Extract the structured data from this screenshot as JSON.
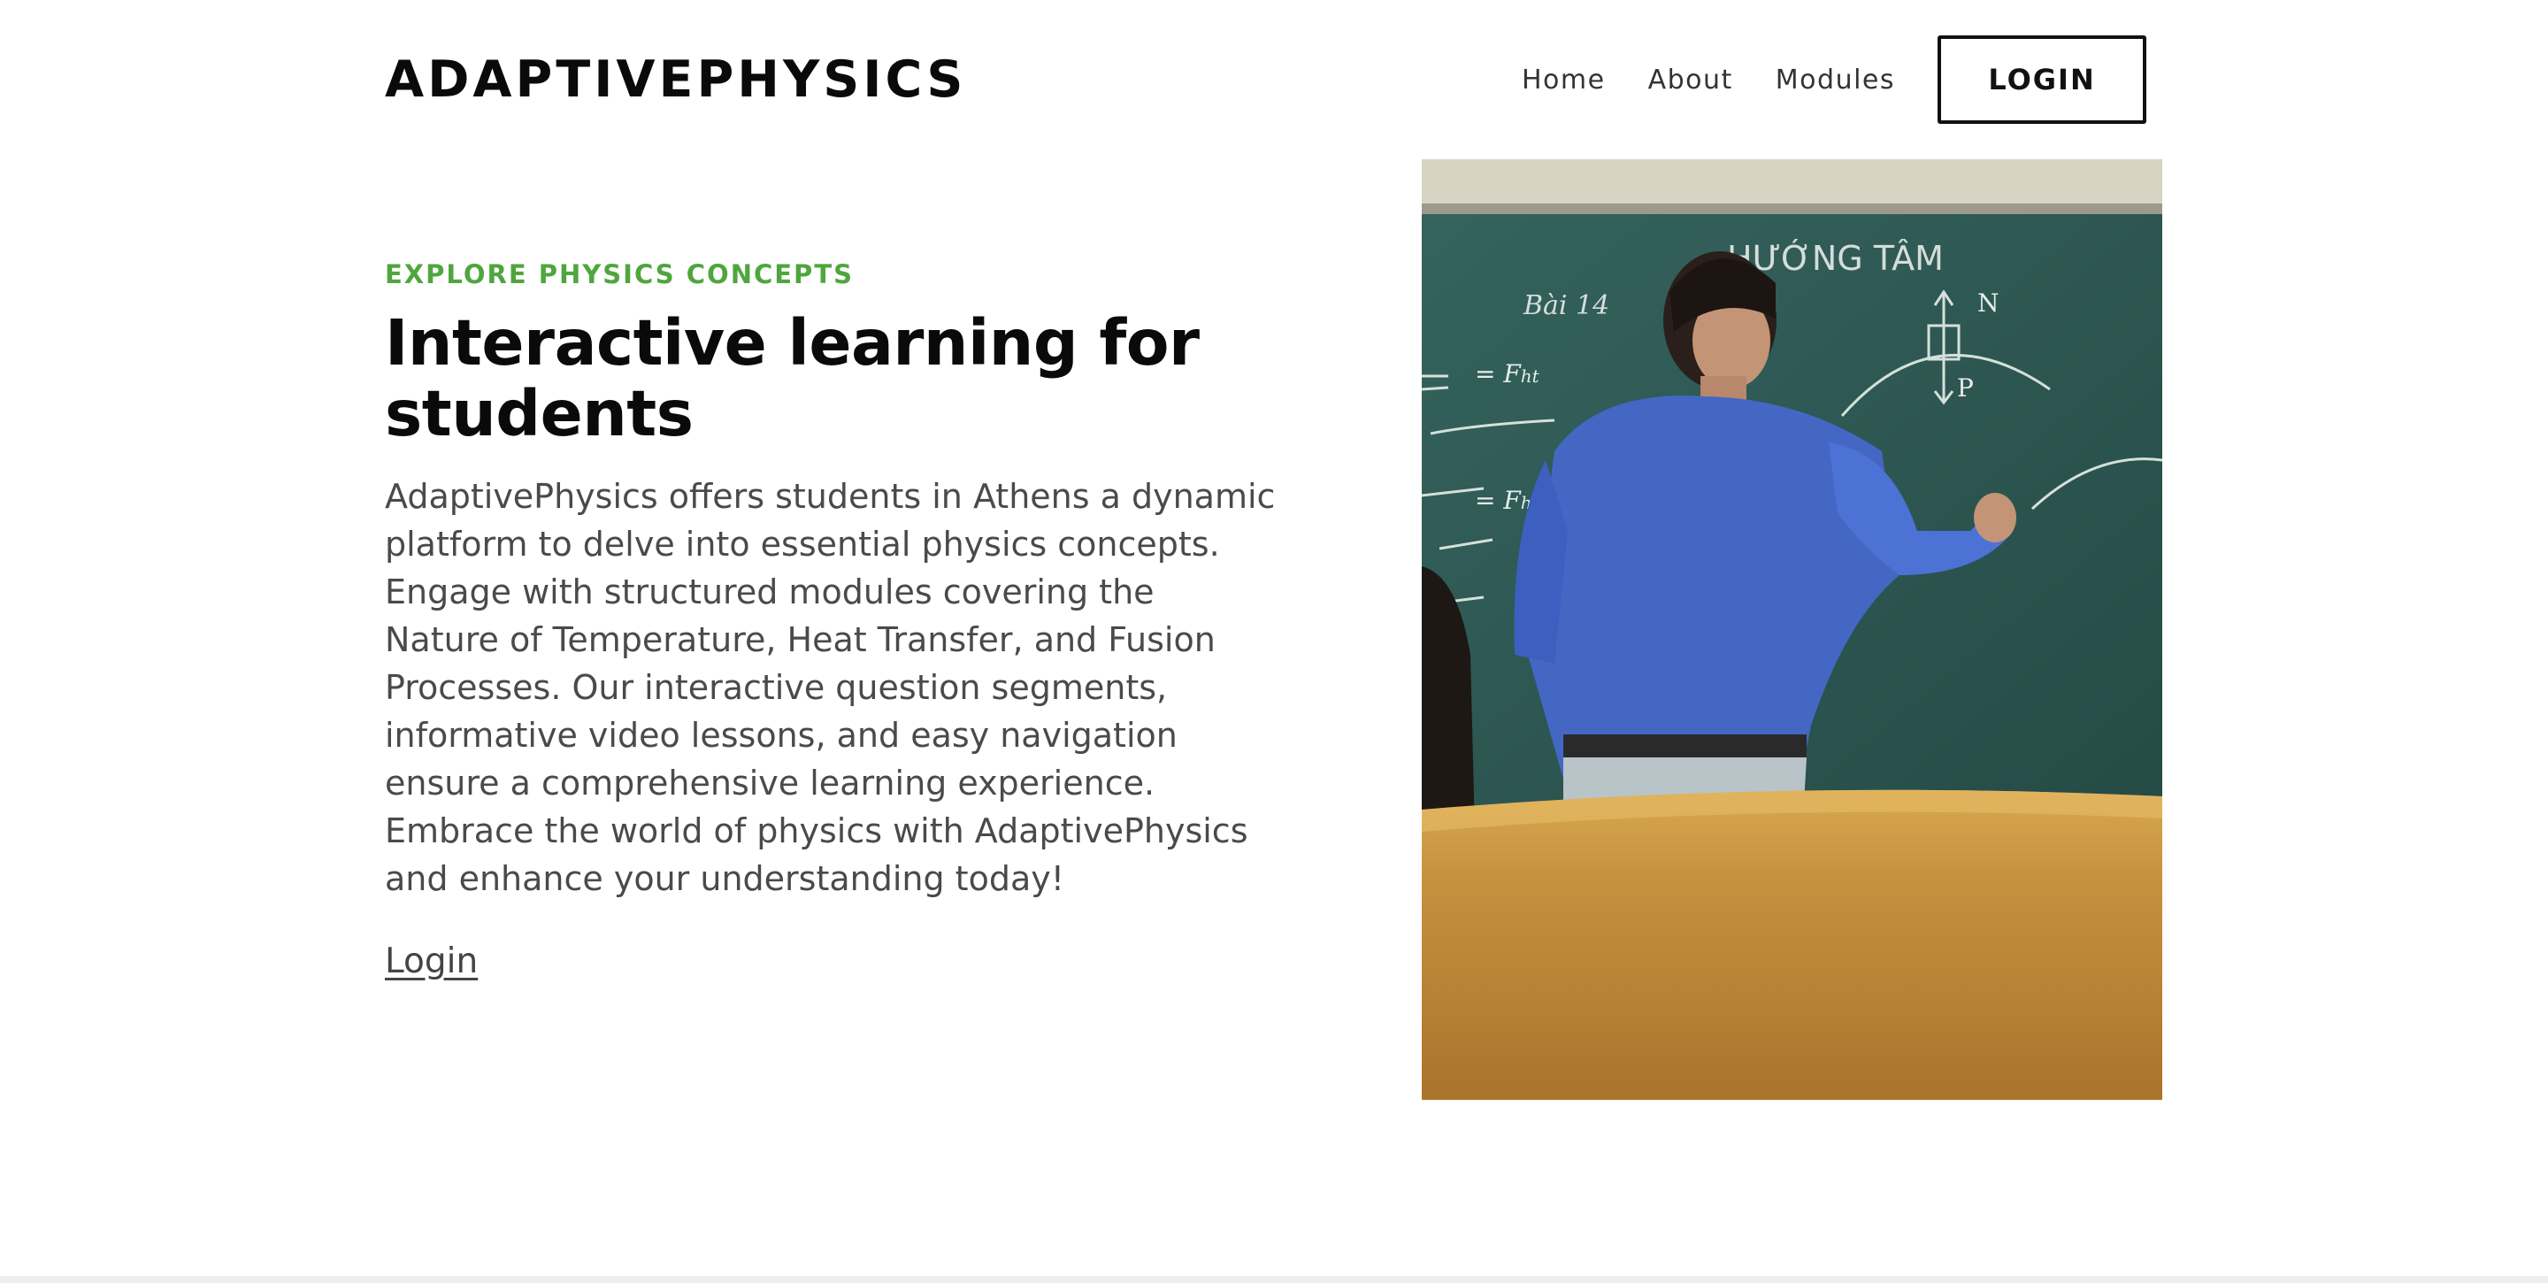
{
  "header": {
    "brand": "ADAPTIVEPHYSICS",
    "nav": [
      {
        "label": "Home"
      },
      {
        "label": "About"
      },
      {
        "label": "Modules"
      }
    ],
    "login_button": "LOGIN"
  },
  "hero": {
    "eyebrow": "EXPLORE PHYSICS CONCEPTS",
    "title": "Interactive learning for students",
    "description": "AdaptivePhysics offers students in Athens a dynamic platform to delve into essential physics concepts. Engage with structured modules covering the Nature of Temperature, Heat Transfer, and Fusion Processes. Our interactive question segments, informative video lessons, and easy navigation ensure a comprehensive learning experience. Embrace the world of physics with AdaptivePhysics and enhance your understanding today!",
    "link": "Login",
    "image": {
      "subject": "teacher writing on chalkboard",
      "board_heading": "HƯỚNG TÂM",
      "board_note": "Bài 14"
    }
  },
  "colors": {
    "accent": "#4fa63e",
    "text": "#111111",
    "body_text": "#4a4a4a",
    "chalkboard": "#2c5652",
    "desk": "#b8843a",
    "shirt": "#4a6fd0"
  }
}
